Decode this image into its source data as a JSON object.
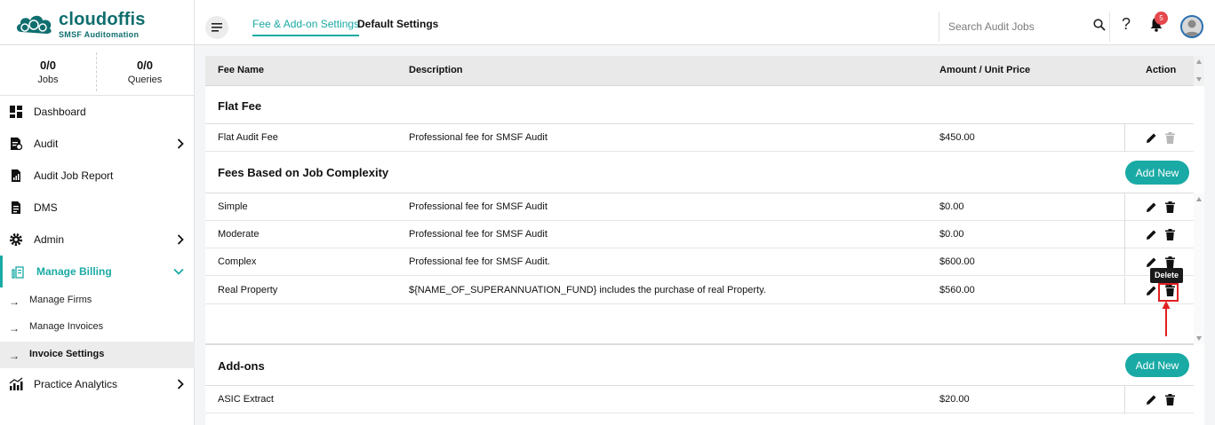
{
  "brand": {
    "name": "cloudoffis",
    "tagline": "SMSF Auditomation"
  },
  "header": {
    "tabs": [
      {
        "label": "Fee & Add-on Settings",
        "active": true
      },
      {
        "label": "Default Settings",
        "active": false
      }
    ],
    "search_placeholder": "Search Audit Jobs",
    "help_label": "?",
    "notification_count": "5"
  },
  "sidebar": {
    "stats": [
      {
        "value": "0/0",
        "label": "Jobs"
      },
      {
        "value": "0/0",
        "label": "Queries"
      }
    ],
    "items": [
      {
        "label": "Dashboard",
        "icon": "dashboard-icon"
      },
      {
        "label": "Audit",
        "icon": "audit-icon",
        "expand": true
      },
      {
        "label": "Audit Job Report",
        "icon": "report-icon"
      },
      {
        "label": "DMS",
        "icon": "document-icon"
      },
      {
        "label": "Admin",
        "icon": "gear-icon",
        "expand": true
      },
      {
        "label": "Manage Billing",
        "icon": "billing-icon",
        "expanded": true
      }
    ],
    "billing_sub_items": [
      {
        "label": "Manage Firms"
      },
      {
        "label": "Manage Invoices"
      },
      {
        "label": "Invoice Settings",
        "selected": true
      }
    ],
    "analytics": {
      "label": "Practice Analytics",
      "icon": "analytics-icon"
    }
  },
  "table": {
    "columns": [
      "Fee Name",
      "Description",
      "Amount / Unit Price",
      "Action"
    ],
    "sections": [
      {
        "title": "Flat Fee",
        "rows": [
          {
            "name": "Flat Audit Fee",
            "description": "Professional fee for SMSF Audit",
            "amount": "$450.00"
          }
        ]
      },
      {
        "title": "Fees Based on Job Complexity",
        "add_label": "Add New",
        "rows": [
          {
            "name": "Simple",
            "description": "Professional fee for SMSF Audit",
            "amount": "$0.00"
          },
          {
            "name": "Moderate",
            "description": "Professional fee for SMSF Audit",
            "amount": "$0.00"
          },
          {
            "name": "Complex",
            "description": "Professional fee for SMSF Audit.",
            "amount": "$600.00"
          },
          {
            "name": "Real Property",
            "description": "${NAME_OF_SUPERANNUATION_FUND} includes the purchase of real Property.",
            "amount": "$560.00"
          }
        ]
      },
      {
        "title": "Add-ons",
        "add_label": "Add New",
        "rows": [
          {
            "name": "ASIC Extract",
            "description": "",
            "amount": "$20.00"
          }
        ]
      }
    ]
  },
  "tooltip": {
    "label": "Delete"
  },
  "colors": {
    "accent": "#1aaaa5",
    "highlight": "#e02020",
    "badge": "#e5484d"
  }
}
